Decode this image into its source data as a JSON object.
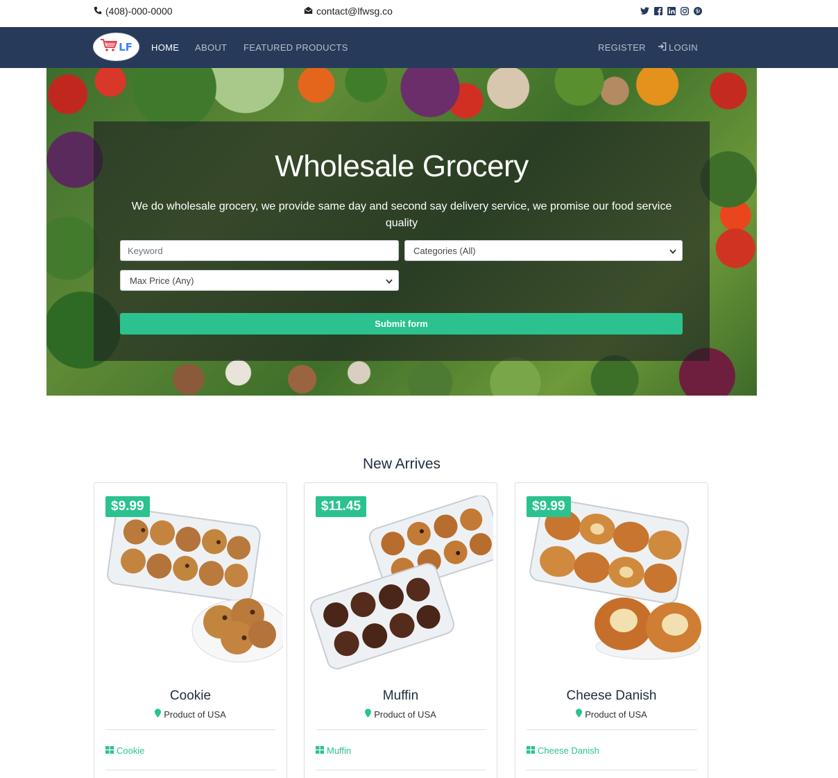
{
  "topbar": {
    "phone": "(408)-000-0000",
    "email": "contact@lfwsg.co",
    "social": [
      "twitter-icon",
      "facebook-icon",
      "linkedin-icon",
      "instagram-icon",
      "pinterest-icon"
    ]
  },
  "nav": {
    "logo_text": "LF",
    "home": "HOME",
    "about": "ABOUT",
    "featured": "FEATURED PRODUCTS",
    "register": "REGISTER",
    "login": "LOGIN"
  },
  "hero": {
    "title": "Wholesale Grocery",
    "subtitle": "We do wholesale grocery, we provide same day and second say delivery service, we promise our food service quality",
    "keyword_placeholder": "Keyword",
    "categories_selected": "Categories (All)",
    "maxprice_selected": "Max Price (Any)",
    "submit_label": "Submit form"
  },
  "section": {
    "title": "New Arrives"
  },
  "products": [
    {
      "price": "$9.99",
      "name": "Cookie",
      "origin": "Product of USA",
      "category": "Cookie"
    },
    {
      "price": "$11.45",
      "name": "Muffin",
      "origin": "Product of USA",
      "category": "Muffin"
    },
    {
      "price": "$9.99",
      "name": "Cheese Danish",
      "origin": "Product of USA",
      "category": "Cheese Danish"
    }
  ],
  "colors": {
    "navbar": "#273a59",
    "accent": "#2bc28f"
  }
}
